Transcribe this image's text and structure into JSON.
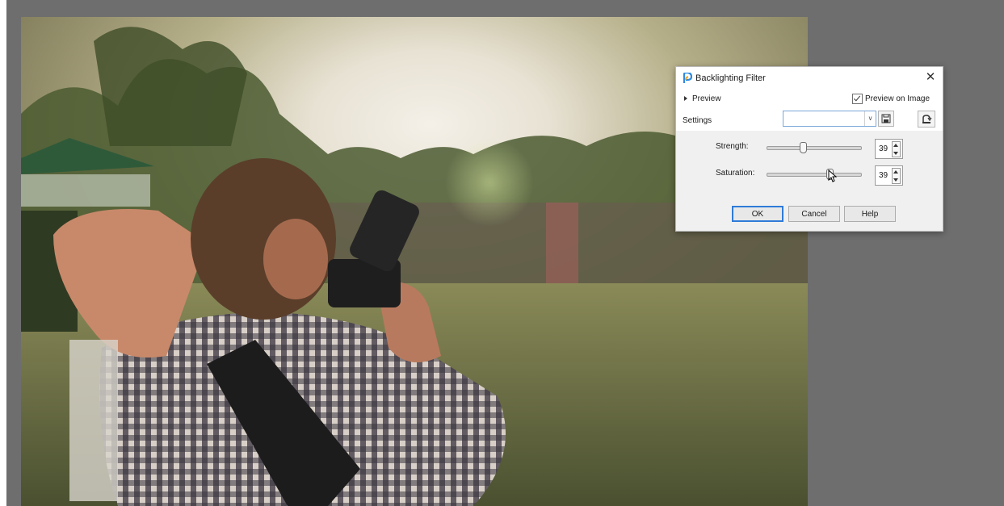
{
  "dialog": {
    "title": "Backlighting Filter",
    "close_icon": "close-icon",
    "preview_label": "Preview",
    "preview_on_image_label": "Preview on Image",
    "preview_on_image_checked": true,
    "settings_label": "Settings",
    "settings_value": "",
    "save_preset_icon": "save-icon",
    "reset_icon": "reset-icon",
    "strength": {
      "label": "Strength:",
      "value": "39"
    },
    "saturation": {
      "label": "Saturation:",
      "value": "39"
    },
    "buttons": {
      "ok": "OK",
      "cancel": "Cancel",
      "help": "Help"
    }
  },
  "colors": {
    "workspace_bg": "#6e6e6e",
    "dialog_bg": "#ffffff",
    "panel_bg": "#f0f0f0",
    "accent": "#2f7bd8"
  }
}
